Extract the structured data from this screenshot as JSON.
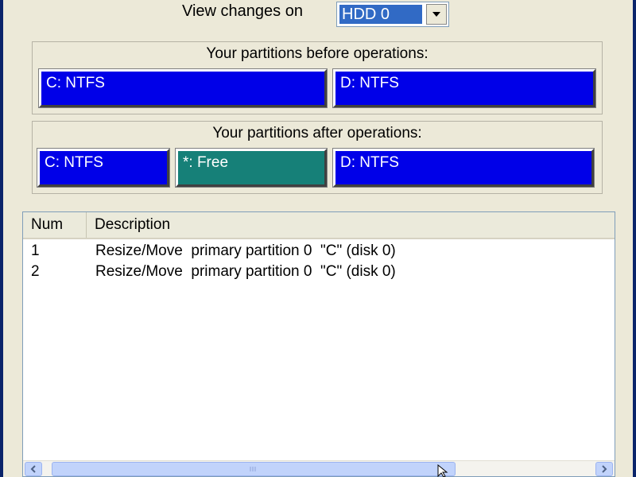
{
  "view_changes": {
    "label": "View changes on",
    "selected_disk": "HDD 0"
  },
  "before": {
    "title": "Your partitions before operations:",
    "partitions": [
      {
        "label": "C: NTFS",
        "color": "#0000E8"
      },
      {
        "label": "D: NTFS",
        "color": "#0000E8"
      }
    ]
  },
  "after": {
    "title": "Your partitions after operations:",
    "partitions": [
      {
        "label": "C: NTFS",
        "color": "#0000E8"
      },
      {
        "label": "*: Free",
        "color": "#168078"
      },
      {
        "label": "D: NTFS",
        "color": "#0000E8"
      }
    ]
  },
  "operations": {
    "columns": [
      "Num",
      "Description"
    ],
    "rows": [
      {
        "num": "1",
        "description": "Resize/Move  primary partition 0  \"C\" (disk 0)"
      },
      {
        "num": "2",
        "description": "Resize/Move  primary partition 0  \"C\" (disk 0)"
      }
    ]
  },
  "icons": {
    "dropdown": "chevron-down-icon",
    "scroll_left": "arrow-left-icon",
    "scroll_right": "arrow-right-icon",
    "cursor": "mouse-pointer-icon"
  }
}
